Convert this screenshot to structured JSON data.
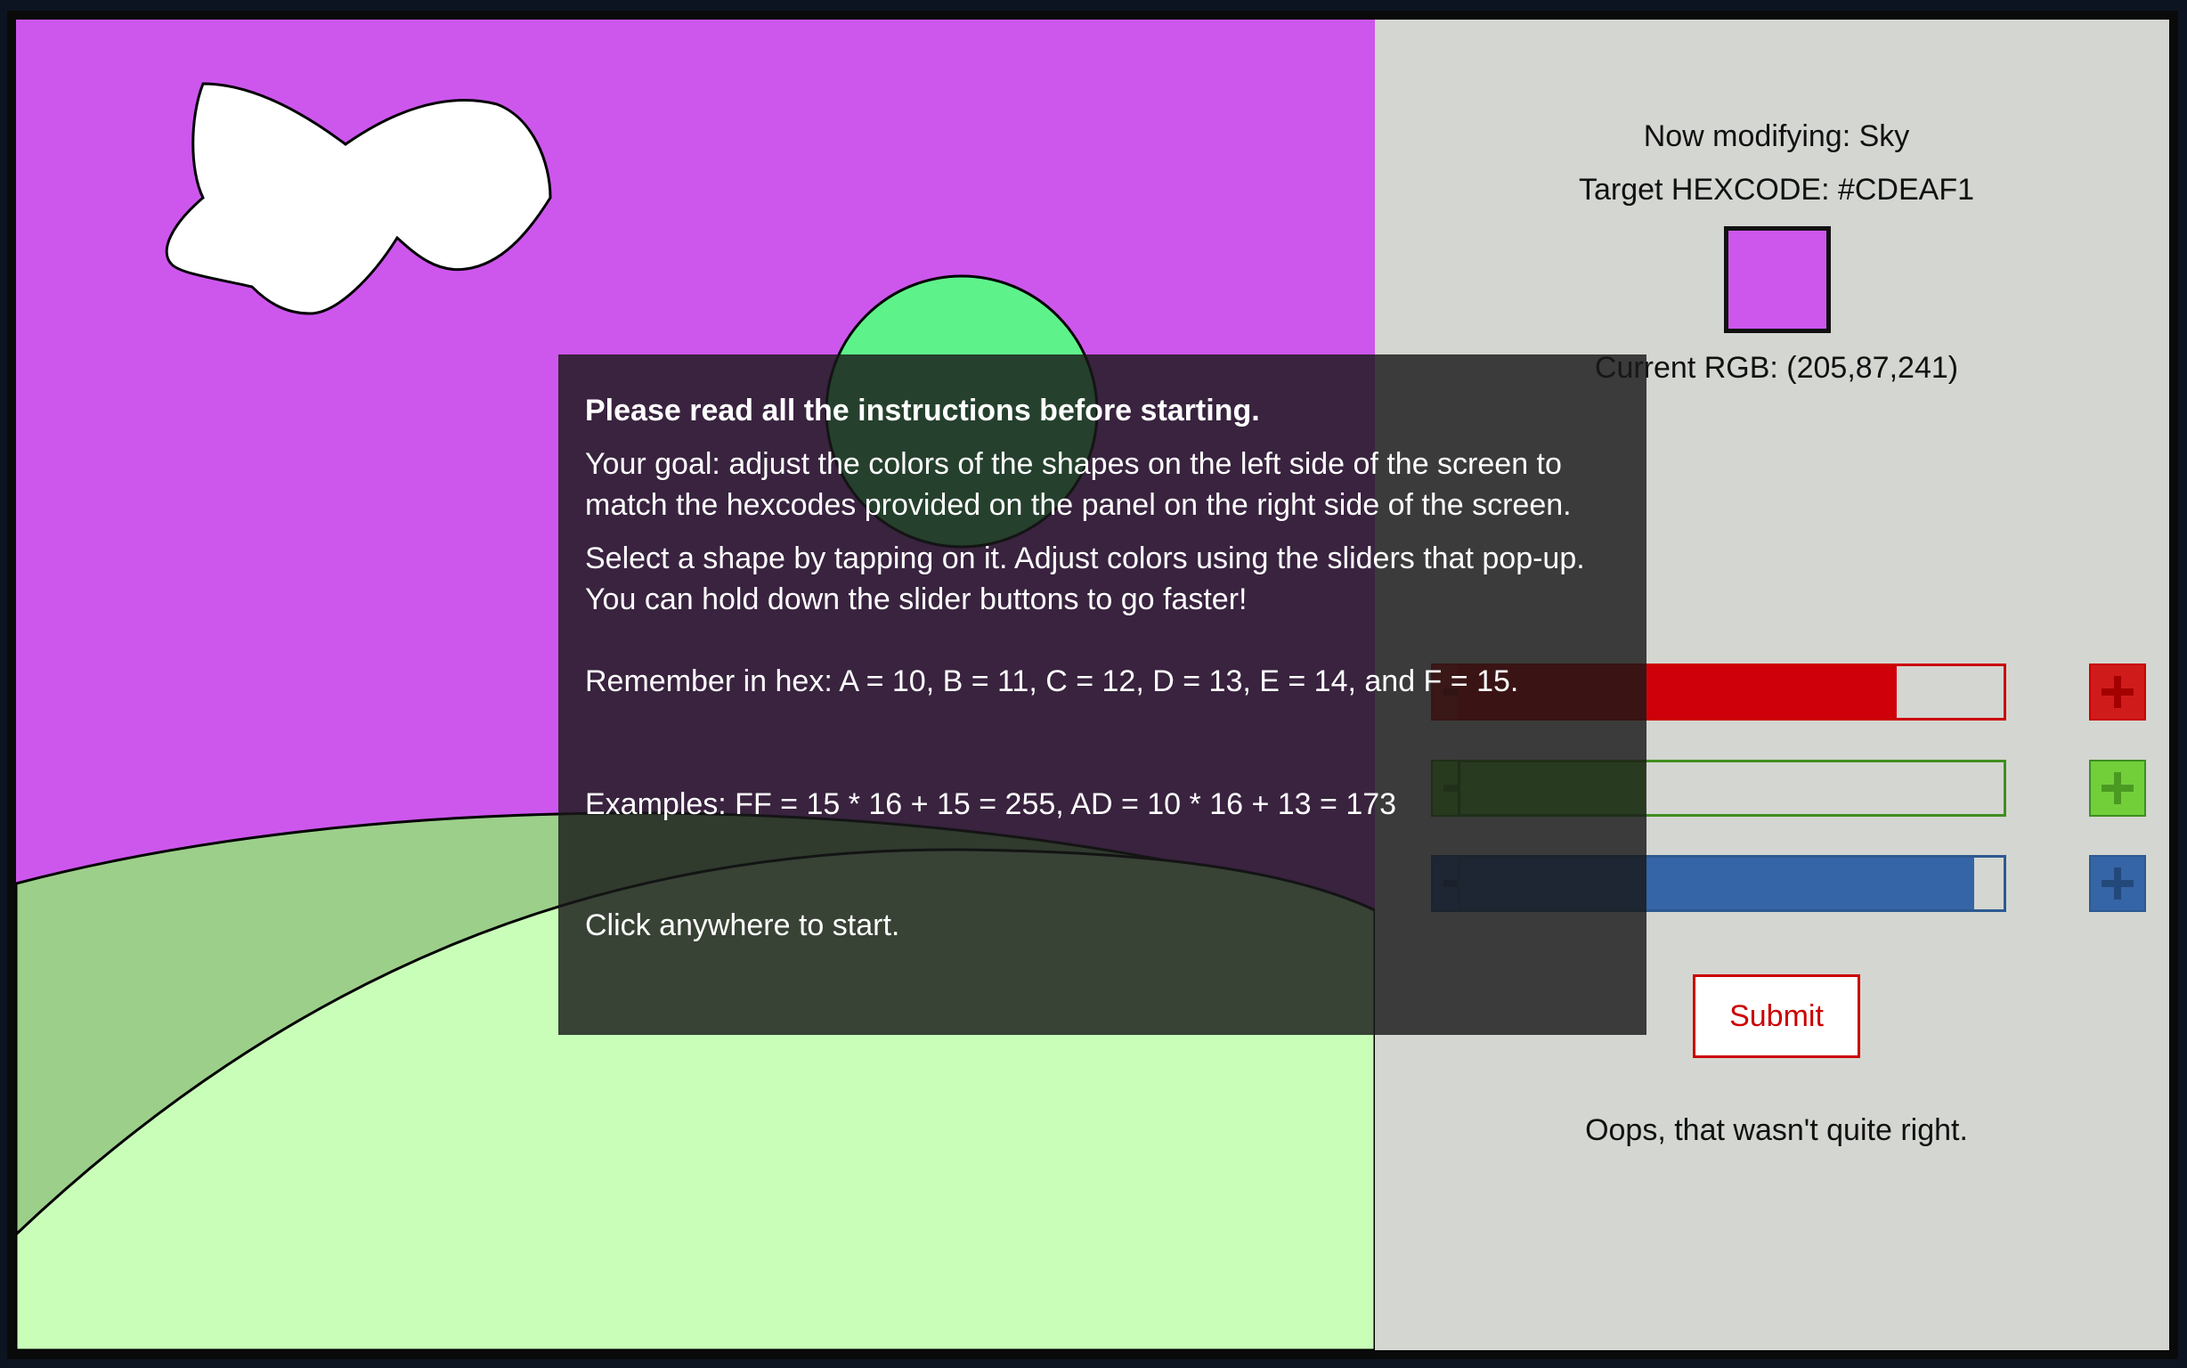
{
  "scene": {
    "sky_color": "#cd57ed",
    "sun_color": "#5ef28b",
    "cloud_color": "#ffffff",
    "back_hill_color": "#9ccf8a",
    "front_hill_color": "#c9feb9",
    "outline_color": "#000000"
  },
  "panel": {
    "modifying_text": "Now modifying: Sky",
    "target_hexcode_text": "Target HEXCODE: #CDEAF1",
    "current_rgb_text": "Current RGB: (205,87,241)",
    "swatch_color": "#cd57ed",
    "sliders": [
      {
        "name": "red",
        "value": 205,
        "max": 255,
        "color": "#cc0000",
        "button_color": "#d01b1b",
        "glyph_color": "#a30000",
        "fill_color": "#d0000a"
      },
      {
        "name": "green",
        "value": 87,
        "max": 255,
        "color": "#3f8f1f",
        "button_color": "#72cf3a",
        "glyph_color": "#4a9a22",
        "fill_color": "#72d43e"
      },
      {
        "name": "blue",
        "value": 241,
        "max": 255,
        "color": "#2d5a91",
        "button_color": "#3565a6",
        "glyph_color": "#23497b",
        "fill_color": "#3565a6"
      }
    ],
    "submit_label": "Submit",
    "feedback_text": "Oops, that wasn't quite right."
  },
  "instructions": {
    "heading": "Please read all the instructions before starting.",
    "goal": "Your goal: adjust the colors of the shapes on the left side of the screen to\nmatch the hexcodes provided on the panel on the right side of the screen.",
    "select": "Select a shape by tapping on it. Adjust colors using the sliders that pop-up.\nYou can hold down the slider buttons to go faster!",
    "hex_note": "Remember in hex: A = 10, B = 11, C = 12, D = 13, E = 14, and F = 15.",
    "examples": "Examples: FF = 15 * 16 + 15 = 255, AD = 10 * 16 + 13 = 173",
    "start": "Click anywhere to start."
  }
}
